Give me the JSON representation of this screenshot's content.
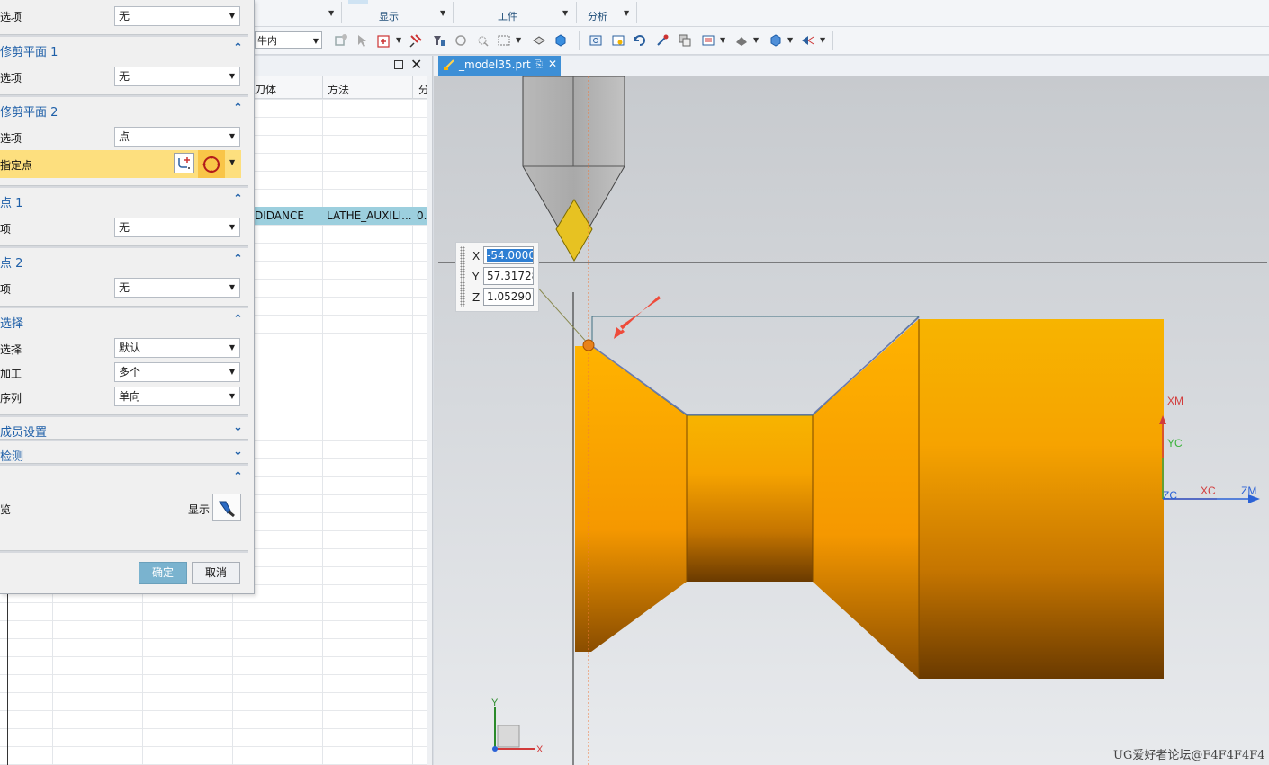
{
  "ribbon": {
    "groups": [
      {
        "label": "显示"
      },
      {
        "label": "工件"
      },
      {
        "label": "分析"
      }
    ]
  },
  "toolbar": {
    "filter_value": "牛内"
  },
  "navigator": {
    "columns": [
      "刀体",
      "方法",
      "分"
    ],
    "selected_row": {
      "tool": "DIDANCE",
      "method": "LATHE_AUXILI...",
      "extra": "0."
    }
  },
  "dialog": {
    "row_options_0": {
      "label": "选项",
      "value": "无"
    },
    "trim_plane_1": {
      "title": "修剪平面 1",
      "option_label": "选项",
      "option_value": "无"
    },
    "trim_plane_2": {
      "title": "修剪平面 2",
      "option_label": "选项",
      "option_value": "点",
      "spec_label": "指定点"
    },
    "point_1": {
      "title": "点 1",
      "option_label": "项",
      "option_value": "无"
    },
    "point_2": {
      "title": "点 2",
      "option_label": "项",
      "option_value": "无"
    },
    "selection": {
      "title": "选择",
      "rows": [
        {
          "label": "选择",
          "value": "默认"
        },
        {
          "label": "加工",
          "value": "多个"
        },
        {
          "label": "序列",
          "value": "单向"
        }
      ]
    },
    "member_settings": {
      "title": "成员设置"
    },
    "check": {
      "title": "检测"
    },
    "preview": {
      "label": "览",
      "show_label": "显示"
    },
    "ok_label": "确定",
    "cancel_label": "取消"
  },
  "graphics": {
    "tab_label": "_model35.prt",
    "coords": {
      "x_label": "X",
      "x_value": "-54.0000",
      "y_label": "Y",
      "y_value": "57.31728",
      "z_label": "Z",
      "z_value": "1.052901"
    },
    "axes": {
      "xm": "XM",
      "yc": "YC",
      "zc": "ZC",
      "xc": "XC",
      "zm": "ZM"
    },
    "triad": {
      "y": "Y",
      "x": "X"
    },
    "watermark": "UG爱好者论坛@F4F4F4F4"
  },
  "colors": {
    "part_orange": "#f5a700",
    "tool_yellow": "#e7c222",
    "accent_blue": "#1e5fa8",
    "highlight_row": "#fddf7e"
  }
}
